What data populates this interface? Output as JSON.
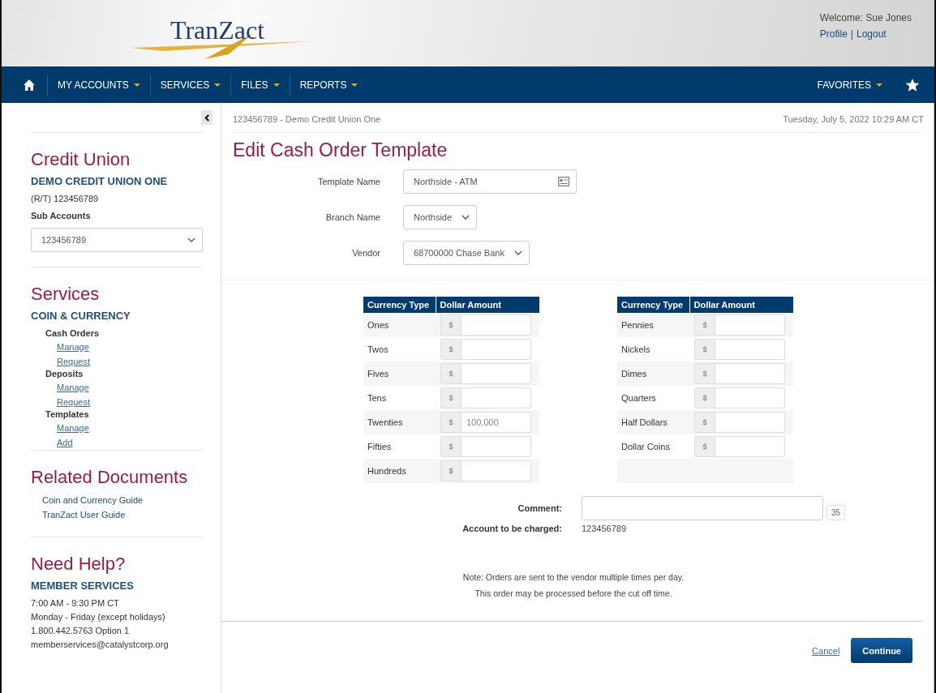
{
  "header": {
    "logo": "TranZact",
    "welcome": "Welcome: Sue Jones",
    "user_links": [
      "Profile",
      "Logout"
    ],
    "link_separator": "|"
  },
  "nav": {
    "items": [
      {
        "label": "MY ACCOUNTS"
      },
      {
        "label": "SERVICES"
      },
      {
        "label": "FILES"
      },
      {
        "label": "REPORTS"
      }
    ],
    "favorites": "FAVORITES"
  },
  "sidebar": {
    "credit_union": {
      "title": "Credit Union",
      "name": "DEMO CREDIT UNION ONE",
      "routing": "(R/T) 123456789",
      "sub_accounts_label": "Sub Accounts",
      "sub_account": "123456789"
    },
    "services": {
      "title": "Services",
      "category": "COIN & CURRENCY",
      "groups": [
        {
          "label": "Cash Orders",
          "children": [
            {
              "label": "Manage"
            },
            {
              "label": "Request"
            }
          ]
        },
        {
          "label": "Deposits",
          "children": [
            {
              "label": "Manage"
            },
            {
              "label": "Request"
            }
          ]
        },
        {
          "label": "Templates",
          "children": [
            {
              "label": "Manage"
            },
            {
              "label": "Add"
            }
          ]
        }
      ]
    },
    "documents": {
      "title": "Related Documents",
      "links": [
        "Coin and Currency Guide",
        "TranZact User Guide"
      ]
    },
    "help": {
      "title": "Need Help?",
      "heading": "MEMBER SERVICES",
      "lines": [
        "7:00 AM - 9:30 PM CT",
        "Monday - Friday (except holidays)",
        "1.800.442.5763 Option 1",
        "memberservices@catalystcorp.org"
      ]
    }
  },
  "main": {
    "breadcrumb": "123456789 - Demo Credit Union One",
    "date": "Tuesday, July 5, 2022 10:29 AM CT",
    "title": "Edit Cash Order Template",
    "fields": [
      {
        "kind": "text",
        "label": "Template Name",
        "value": "Northside - ATM"
      },
      {
        "kind": "select",
        "label": "Branch Name",
        "value": "Northside"
      },
      {
        "kind": "select",
        "label": "Vendor",
        "value": "68700000 Chase Bank"
      }
    ],
    "tables": [
      {
        "columns": [
          "Currency Type",
          "Dollar Amount"
        ],
        "rows": [
          {
            "type": "Ones",
            "prefix": "$",
            "value": ""
          },
          {
            "type": "Twos",
            "prefix": "$",
            "value": ""
          },
          {
            "type": "Fives",
            "prefix": "$",
            "value": ""
          },
          {
            "type": "Tens",
            "prefix": "$",
            "value": ""
          },
          {
            "type": "Twenties",
            "prefix": "$",
            "placeholder": "100,000"
          },
          {
            "type": "Fifties",
            "prefix": "$",
            "value": ""
          },
          {
            "type": "Hundreds",
            "prefix": "$",
            "value": ""
          }
        ]
      },
      {
        "columns": [
          "Currency Type",
          "Dollar Amount"
        ],
        "rows": [
          {
            "type": "Pennies",
            "prefix": "$",
            "value": ""
          },
          {
            "type": "Nickels",
            "prefix": "$",
            "value": ""
          },
          {
            "type": "Dimes",
            "prefix": "$",
            "value": ""
          },
          {
            "type": "Quarters",
            "prefix": "$",
            "value": ""
          },
          {
            "type": "Half Dollars",
            "prefix": "$",
            "value": ""
          },
          {
            "type": "Dollar Coins",
            "prefix": "$",
            "value": ""
          }
        ]
      }
    ],
    "comment_label": "Comment:",
    "comment_counter": "35",
    "account_label": "Account to be charged:",
    "account_value": "123456789",
    "notes": [
      "Note: Orders are sent to the vendor multiple times per day.",
      "This order may be processed before the cut off time."
    ],
    "buttons": {
      "cancel": "Cancel",
      "continue": "Continue"
    }
  }
}
